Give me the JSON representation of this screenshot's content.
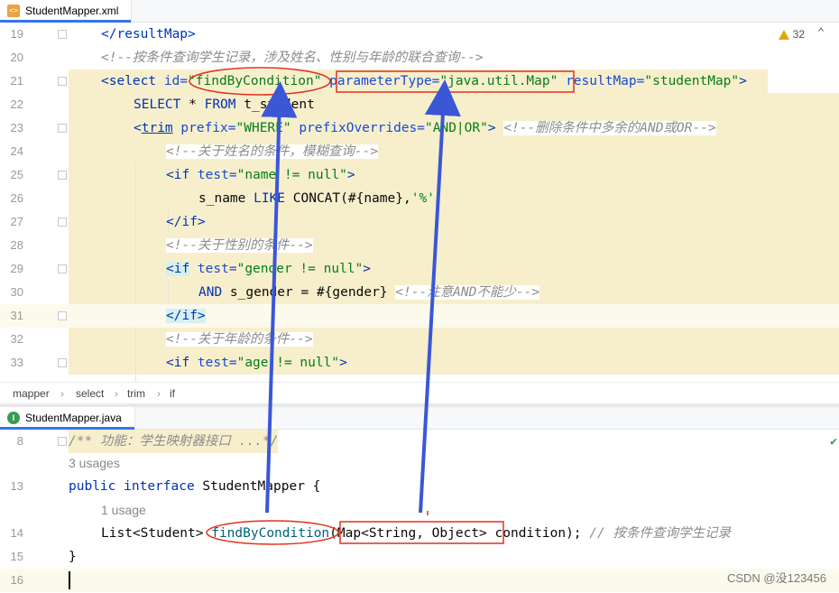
{
  "xml_tab": {
    "title": "StudentMapper.xml"
  },
  "java_tab": {
    "title": "StudentMapper.java"
  },
  "inspection": {
    "count": "32"
  },
  "xml_lines": {
    "l19": {
      "num": "19",
      "close": "</resultMap>"
    },
    "l20": {
      "num": "20",
      "comment": "<!--按条件查询学生记录，涉及姓名、性别与年龄的联合查询-->"
    },
    "l21": {
      "num": "21",
      "open": "<select",
      "a1": " id=",
      "v1": "\"findByCondition\"",
      "a2": "parameterType=",
      "v2": "\"java.util.Map\"",
      "a3": " resultMap=",
      "v3": "\"studentMap\"",
      "end": ">"
    },
    "l22": {
      "num": "22",
      "kw1": "SELECT",
      "op": " * ",
      "kw2": "FROM",
      "rest": " t_student"
    },
    "l23": {
      "num": "23",
      "lt": "<",
      "tag": "trim",
      "a1": " prefix=",
      "v1": "\"WHERE\"",
      "a2": " prefixOverrides=",
      "v2": "\"AND|OR\"",
      "end": ">",
      "comment": "<!--删除条件中多余的AND或OR-->"
    },
    "l24": {
      "num": "24",
      "comment": "<!--关于姓名的条件，模糊查询-->"
    },
    "l25": {
      "num": "25",
      "open": "<if",
      "a1": " test=",
      "v1": "\"name != null\"",
      "end": ">"
    },
    "l26": {
      "num": "26",
      "pre": "s_name ",
      "kw": "LIKE",
      "mid": " CONCAT(#{name},",
      "str": "'%'",
      "post": ")"
    },
    "l27": {
      "num": "27",
      "close": "</if>"
    },
    "l28": {
      "num": "28",
      "comment": "<!--关于性别的条件-->"
    },
    "l29": {
      "num": "29",
      "lt": "<",
      "tag": "if",
      "a1": " test=",
      "v1": "\"gender != null\"",
      "end": ">"
    },
    "l30": {
      "num": "30",
      "kw": "AND",
      "rest": " s_gender = #{gender}",
      "comment": "<!--注意AND不能少-->"
    },
    "l31": {
      "num": "31",
      "close": "</if>"
    },
    "l32": {
      "num": "32",
      "comment": "<!--关于年龄的条件-->"
    },
    "l33": {
      "num": "33",
      "open": "<if",
      "a1": " test=",
      "v1": "\"age != null\"",
      "end": ">"
    }
  },
  "breadcrumbs": [
    "mapper",
    "select",
    "trim",
    "if"
  ],
  "java_lines": {
    "l8": {
      "num": "8",
      "comment": "/** 功能：学生映射器接口 ...*/"
    },
    "usages3": "3 usages",
    "l13": {
      "num": "13",
      "kw1": "public",
      "kw2": "interface",
      "name": " StudentMapper {"
    },
    "usage1": "1 usage",
    "l14": {
      "num": "14",
      "pre": "List<Student> ",
      "method": "findByCondition",
      "params": "(Map<String, Object>",
      "rest": " condition); ",
      "comment": "// 按条件查询学生记录"
    },
    "l15": {
      "num": "15",
      "brace": "}"
    },
    "l16": {
      "num": "16"
    }
  },
  "watermark": "CSDN @没123456",
  "colors": {
    "annotation_red": "#e0301e",
    "arrow_blue": "#3a57d6",
    "highlight": "#f7efcc"
  }
}
